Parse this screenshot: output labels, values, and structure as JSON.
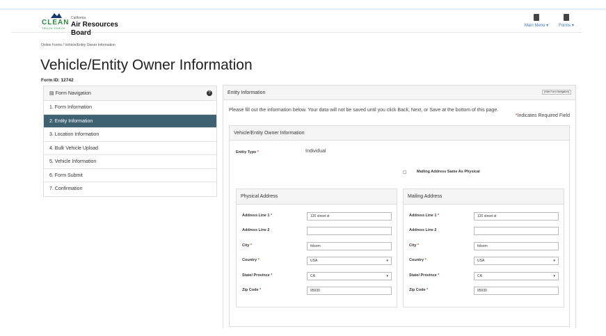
{
  "header": {
    "logo_clean": "CLEAN",
    "logo_truck_check": "TRUCK CHECK",
    "logo_state": "California",
    "logo_board": "Air Resources Board",
    "main_menu": "Main Menu",
    "forms": "Forms"
  },
  "breadcrumb": "Online Forms / Vehicle/Entity Owner Information",
  "page_title": "Vehicle/Entity Owner Information",
  "form_id": "Form ID: 12742",
  "nav": {
    "title": "Form Navigation",
    "help": "?",
    "items": [
      {
        "label": "1. Form Information"
      },
      {
        "label": "2. Entity Information"
      },
      {
        "label": "3. Location Information"
      },
      {
        "label": "4. Bulk Vehicle Upload"
      },
      {
        "label": "5. Vehicle Information"
      },
      {
        "label": "6. Form Submit"
      },
      {
        "label": "7. Confirmation"
      }
    ]
  },
  "main": {
    "title": "Entity Information",
    "hide_nav": "[Hide Form Navigation]",
    "intro": "Please fill out the information below. Your data will not be saved until you click Back, Next, or Save at the bottom of this page.",
    "required_note": "Indicates Required Field",
    "owner_panel_title": "Vehicle/Entity Owner Information",
    "entity_type_label": "Entity Type",
    "entity_type_value": "Individual",
    "same_as_physical": "Mailing Address Same As Physical"
  },
  "physical": {
    "title": "Physical Address",
    "address_line_1_label": "Address Line 1",
    "address_line_1": "120 street st",
    "address_line_2_label": "Address Line 2",
    "address_line_2": "",
    "city_label": "City",
    "city": "folsom",
    "country_label": "Country",
    "country": "USA",
    "state_label": "State/ Province",
    "state": "CA",
    "zip_label": "Zip Code",
    "zip": "95630"
  },
  "mailing": {
    "title": "Mailing Address",
    "address_line_1_label": "Address Line 1",
    "address_line_1": "120 street st",
    "address_line_2_label": "Address Line 2",
    "address_line_2": "",
    "city_label": "City",
    "city": "folsom",
    "country_label": "Country",
    "country": "USA",
    "state_label": "State/ Province",
    "state": "CA",
    "zip_label": "Zip Code",
    "zip": "95630"
  },
  "colors": {
    "active_nav": "#3f6272",
    "logo_green": "#2e8a3e",
    "required": "#c0392b",
    "link": "#3a7ab8"
  }
}
